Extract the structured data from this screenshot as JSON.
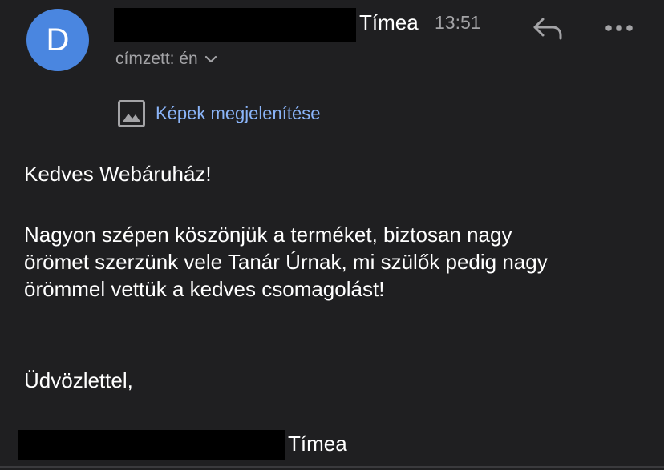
{
  "header": {
    "avatar_letter": "D",
    "sender_name": "Tímea",
    "time": "13:51",
    "recipient_label": "címzett: én"
  },
  "images": {
    "show_label": "Képek megjelenítése"
  },
  "message": {
    "greeting": "Kedves Webáruház!",
    "paragraph_lines": [
      "Nagyon szépen köszönjük a terméket, biztosan nagy",
      "örömet szerzünk vele Tanár Úrnak, mi szülők pedig nagy",
      "örömmel vettük a kedves csomagolást!"
    ],
    "closing": "Üdvözlettel,",
    "signature_name": "Tímea"
  },
  "icons": {
    "reply": "reply-icon",
    "more": "more-horizontal-icon",
    "chevron": "chevron-down-icon",
    "image": "image-icon"
  },
  "colors": {
    "background": "#1f1f21",
    "avatar": "#4a86e0",
    "link": "#8ab4f8",
    "muted": "#a3a3a6"
  }
}
